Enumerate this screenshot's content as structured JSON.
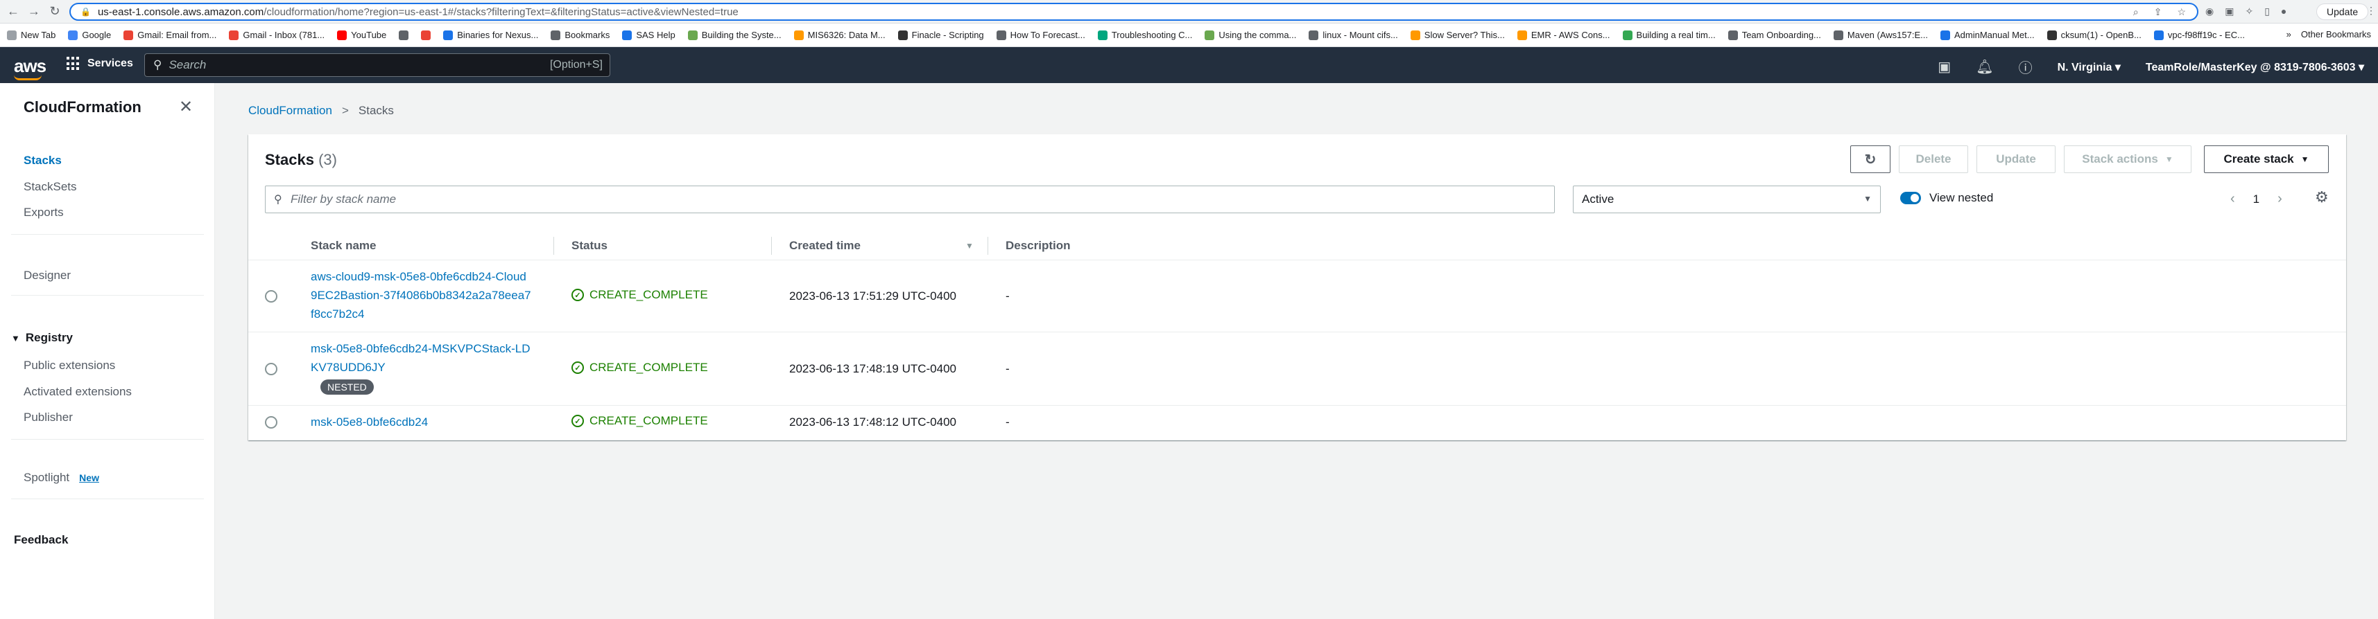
{
  "browser": {
    "url_host": "us-east-1.console.aws.amazon.com",
    "url_rest": "/cloudformation/home?region=us-east-1#/stacks?filteringText=&filteringStatus=active&viewNested=true",
    "update_label": "Update",
    "bookmarks": [
      {
        "label": "New Tab",
        "color": "#9aa0a6"
      },
      {
        "label": "Google",
        "color": "#4285f4"
      },
      {
        "label": "Gmail: Email from...",
        "color": "#ea4335"
      },
      {
        "label": "Gmail - Inbox (781...",
        "color": "#ea4335"
      },
      {
        "label": "YouTube",
        "color": "#ff0000"
      },
      {
        "label": "",
        "color": "#5f6368"
      },
      {
        "label": "",
        "color": "#ea4335"
      },
      {
        "label": "Binaries for Nexus...",
        "color": "#1a73e8"
      },
      {
        "label": "Bookmarks",
        "color": "#5f6368"
      },
      {
        "label": "SAS Help",
        "color": "#1a73e8"
      },
      {
        "label": "Building the Syste...",
        "color": "#6aa84f"
      },
      {
        "label": "MIS6326: Data M...",
        "color": "#ff9900"
      },
      {
        "label": "Finacle - Scripting",
        "color": "#333333"
      },
      {
        "label": "How To Forecast...",
        "color": "#5f6368"
      },
      {
        "label": "Troubleshooting C...",
        "color": "#00a67e"
      },
      {
        "label": "Using the comma...",
        "color": "#6aa84f"
      },
      {
        "label": "linux - Mount cifs...",
        "color": "#5f6368"
      },
      {
        "label": "Slow Server? This...",
        "color": "#ff9900"
      },
      {
        "label": "EMR - AWS Cons...",
        "color": "#ff9900"
      },
      {
        "label": "Building a real tim...",
        "color": "#34a853"
      },
      {
        "label": "Team Onboarding...",
        "color": "#5f6368"
      },
      {
        "label": "Maven (Aws157:E...",
        "color": "#5f6368"
      },
      {
        "label": "AdminManual Met...",
        "color": "#1a73e8"
      },
      {
        "label": "cksum(1) - OpenB...",
        "color": "#333333"
      },
      {
        "label": "vpc-f98ff19c - EC...",
        "color": "#1a73e8"
      }
    ],
    "other_bookmarks": "Other Bookmarks",
    "more_bookmarks": "»"
  },
  "aws_nav": {
    "logo": "aws",
    "services": "Services",
    "search_placeholder": "Search",
    "search_shortcut": "[Option+S]",
    "region": "N. Virginia",
    "account": "TeamRole/MasterKey @ 8319-7806-3603"
  },
  "sidebar": {
    "title": "CloudFormation",
    "items": [
      "Stacks",
      "StackSets",
      "Exports"
    ],
    "designer": "Designer",
    "registry_title": "Registry",
    "registry_items": [
      "Public extensions",
      "Activated extensions",
      "Publisher"
    ],
    "spotlight": "Spotlight",
    "spotlight_badge": "New",
    "feedback": "Feedback"
  },
  "breadcrumb": {
    "root": "CloudFormation",
    "separator": ">",
    "current": "Stacks"
  },
  "stacks_panel": {
    "title": "Stacks",
    "count": "(3)",
    "buttons": {
      "delete": "Delete",
      "update": "Update",
      "stack_actions": "Stack actions",
      "create_stack": "Create stack"
    },
    "filter_placeholder": "Filter by stack name",
    "status_filter": "Active",
    "view_nested_label": "View nested",
    "page": "1",
    "columns": [
      "Stack name",
      "Status",
      "Created time",
      "Description"
    ],
    "rows": [
      {
        "name": "aws-cloud9-msk-05e8-0bfe6cdb24-Cloud9EC2Bastion-37f4086b0b8342a2a78eea7f8cc7b2c4",
        "nested": "",
        "status": "CREATE_COMPLETE",
        "created": "2023-06-13 17:51:29 UTC-0400",
        "description": "-"
      },
      {
        "name": "msk-05e8-0bfe6cdb24-MSKVPCStack-LDKV78UDD6JY",
        "nested": "NESTED",
        "status": "CREATE_COMPLETE",
        "created": "2023-06-13 17:48:19 UTC-0400",
        "description": "-"
      },
      {
        "name": "msk-05e8-0bfe6cdb24",
        "nested": "",
        "status": "CREATE_COMPLETE",
        "created": "2023-06-13 17:48:12 UTC-0400",
        "description": "-"
      }
    ]
  },
  "colors": {
    "aws_nav_bg": "#232f3e",
    "link": "#0073bb",
    "success": "#1d8102",
    "accent_orange": "#ff9900"
  },
  "icons": {
    "refresh": "refresh-icon",
    "settings": "gear-icon",
    "search": "search-icon",
    "close": "close-icon",
    "status_ok": "check-circle-icon"
  }
}
